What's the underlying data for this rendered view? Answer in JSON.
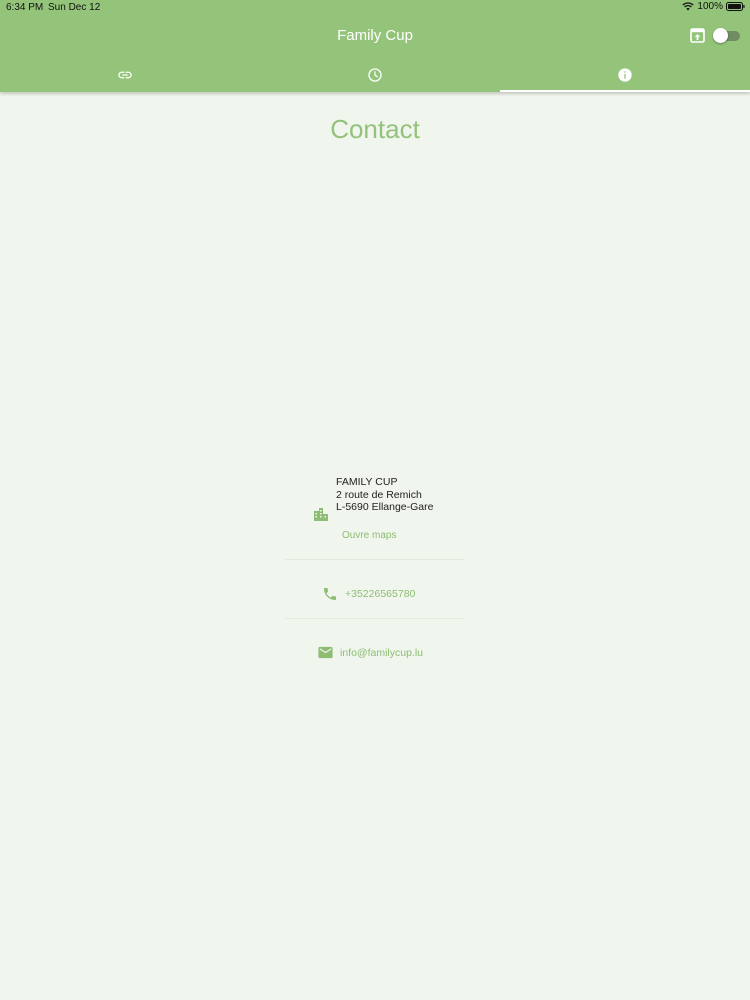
{
  "status_bar": {
    "time": "6:34 PM",
    "date": "Sun Dec 12",
    "battery": "100%"
  },
  "app_bar": {
    "title": "Family Cup",
    "toggle_on": false
  },
  "tabs": [
    {
      "icon": "link-icon",
      "selected": false
    },
    {
      "icon": "clock-icon",
      "selected": false
    },
    {
      "icon": "info-icon",
      "selected": true
    }
  ],
  "page": {
    "title": "Contact"
  },
  "contact": {
    "address": {
      "name": "FAMILY CUP",
      "street": "2 route de Remich",
      "city": "L-5690 Ellange-Gare",
      "maps_label": "Ouvre maps",
      "icon": "building-icon"
    },
    "phone": {
      "number": "+35226565780",
      "icon": "phone-icon"
    },
    "email": {
      "address": "info@familycup.lu",
      "icon": "mail-icon"
    }
  },
  "colors": {
    "accent": "#94c47a",
    "background": "#f0f5ed",
    "link": "#8dbd73"
  }
}
